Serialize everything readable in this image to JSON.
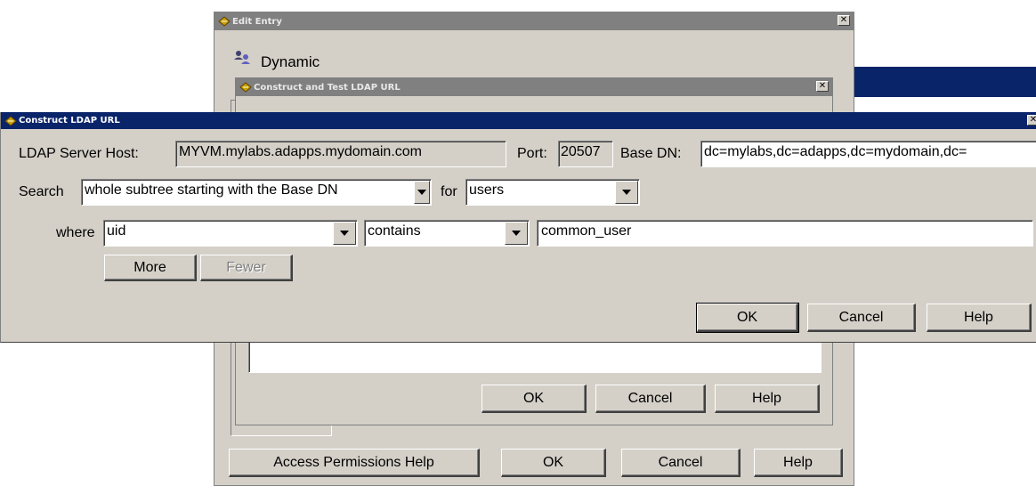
{
  "edit_entry": {
    "title": "Edit Entry",
    "heading": "Dynamic",
    "buttons": {
      "access_help": "Access Permissions Help",
      "ok": "OK",
      "cancel": "Cancel",
      "help": "Help"
    }
  },
  "construct_test": {
    "title": "Construct and Test LDAP URL",
    "buttons": {
      "ok": "OK",
      "cancel": "Cancel",
      "help": "Help"
    }
  },
  "construct": {
    "title": "Construct LDAP URL",
    "server_host_label": "LDAP Server Host:",
    "server_host_value": "MYVM.mylabs.adapps.mydomain.com",
    "port_label": "Port:",
    "port_value": "20507",
    "base_dn_label": "Base DN:",
    "base_dn_value": "dc=mylabs,dc=adapps,dc=mydomain,dc=",
    "search_label": "Search",
    "search_scope": "whole subtree starting with the Base DN",
    "for_label": "for",
    "for_value": "users",
    "where_label": "where",
    "where_attribute": "uid",
    "where_operator": "contains",
    "where_value": "common_user",
    "more_label": "More",
    "fewer_label": "Fewer",
    "ok_label": "OK",
    "cancel_label": "Cancel",
    "help_label": "Help"
  },
  "colors": {
    "active_title": "#0a246a",
    "inactive_title": "#808080",
    "face": "#d4d0c8"
  }
}
